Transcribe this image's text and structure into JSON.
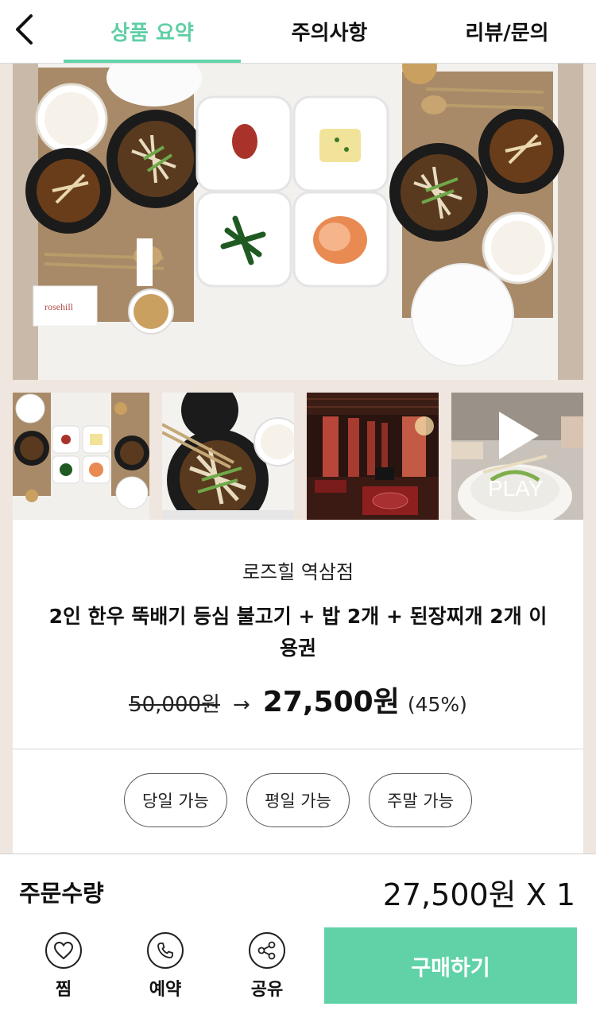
{
  "header": {
    "tabs": [
      {
        "label": "상품 요약",
        "active": true
      },
      {
        "label": "주의사항",
        "active": false
      },
      {
        "label": "리뷰/문의",
        "active": false
      }
    ]
  },
  "gallery": {
    "main_image": "food-table-photo",
    "thumbnails": [
      "table-overview",
      "bulgogi-closeup",
      "restaurant-interior",
      "video"
    ],
    "play_label": "PLAY"
  },
  "product": {
    "store_name": "로즈힐 역삼점",
    "title": "2인 한우 뚝배기 등심 불고기 + 밥 2개 + 된장찌개 2개 이용권",
    "original_price": "50,000원",
    "arrow": "→",
    "sale_price": "27,500원",
    "discount": "(45%)"
  },
  "chips": [
    "당일 가능",
    "평일 가능",
    "주말 가능"
  ],
  "order": {
    "qty_label": "주문수량",
    "price_qty": "27,500원 X 1"
  },
  "actions": [
    {
      "label": "찜",
      "icon": "heart-icon"
    },
    {
      "label": "예약",
      "icon": "phone-icon"
    },
    {
      "label": "공유",
      "icon": "share-icon"
    }
  ],
  "buy_label": "구매하기",
  "colors": {
    "accent": "#62d4aa",
    "background": "#efe6df"
  }
}
